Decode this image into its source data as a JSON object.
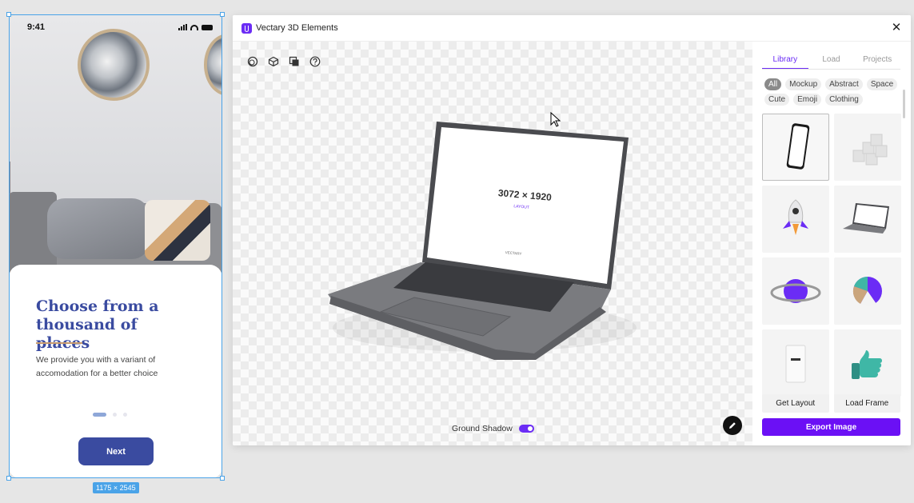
{
  "phone": {
    "time": "9:41",
    "title": "Choose from a thousand of places",
    "description": "We provide you with a variant of accomodation for a better choice",
    "next_label": "Next",
    "size_badge": "1175 × 2545"
  },
  "plugin": {
    "title": "Vectary 3D Elements",
    "accent": "#6b10f5",
    "viewport": {
      "tools": [
        "orbit-icon",
        "cube-icon",
        "layers-icon",
        "help-icon"
      ],
      "laptop_screen_title": "3072 × 1920",
      "laptop_screen_subtitle": "LAYOUT",
      "laptop_screen_brand": "VECTARY",
      "ground_shadow_label": "Ground Shadow",
      "ground_shadow_on": true
    },
    "sidebar": {
      "tabs": [
        {
          "label": "Library",
          "active": true
        },
        {
          "label": "Load",
          "active": false
        },
        {
          "label": "Projects",
          "active": false
        }
      ],
      "chips": [
        {
          "label": "All",
          "active": true
        },
        {
          "label": "Mockup",
          "active": false
        },
        {
          "label": "Abstract",
          "active": false
        },
        {
          "label": "Space",
          "active": false
        },
        {
          "label": "Cute",
          "active": false
        },
        {
          "label": "Emoji",
          "active": false
        },
        {
          "label": "Clothing",
          "active": false
        }
      ],
      "tiles": [
        "phone-mockup",
        "abstract-steps",
        "rocket",
        "laptop-mockup",
        "planet-ring",
        "pie-sphere",
        "coffee-bag",
        "thumbs-up-glove"
      ],
      "get_layout_label": "Get Layout",
      "load_frame_label": "Load Frame",
      "export_label": "Export Image"
    }
  }
}
